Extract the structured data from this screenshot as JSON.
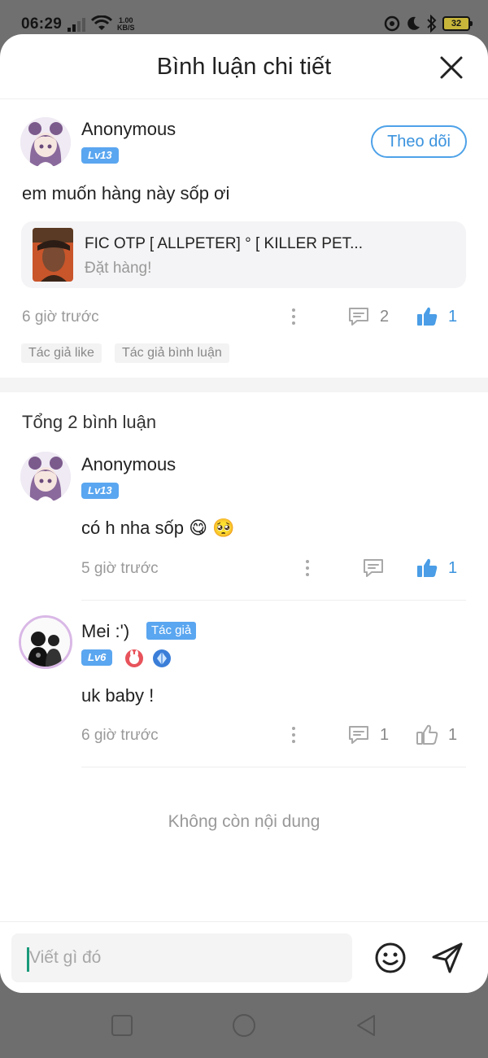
{
  "status_bar": {
    "time": "06:29",
    "net_speed_value": "1.00",
    "net_speed_unit": "KB/S",
    "battery": "32"
  },
  "header": {
    "title": "Bình luận chi tiết",
    "close_icon": "close-icon"
  },
  "main_post": {
    "username": "Anonymous",
    "level": "Lv13",
    "follow_label": "Theo dõi",
    "text": "em muốn hàng này sốp ơi",
    "product": {
      "title": "FIC OTP [ ALLPETER] ° [ KILLER PET...",
      "subtitle": "Đặt hàng!"
    },
    "time": "6 giờ trước",
    "comment_count": "2",
    "like_count": "1",
    "tags": [
      "Tác giả like",
      "Tác giả bình luận"
    ]
  },
  "replies": {
    "total_label": "Tổng 2 bình luận",
    "items": [
      {
        "username": "Anonymous",
        "level": "Lv13",
        "text": "có h nha sốp 😋 🥺",
        "time": "5 giờ trước",
        "like_count": "1"
      },
      {
        "username": "Mei :')",
        "author_tag": "Tác giả",
        "level": "Lv6",
        "text": "uk baby !",
        "time": "6 giờ trước",
        "comment_count": "1",
        "like_count": "1"
      }
    ],
    "no_more": "Không còn nội dung"
  },
  "input_bar": {
    "placeholder": "Viết gì đó",
    "emoji_icon": "smile-icon",
    "send_icon": "send-icon"
  },
  "colors": {
    "accent_blue": "#3b93de",
    "level_badge": "#5aa6f0",
    "muted_text": "#999999"
  }
}
